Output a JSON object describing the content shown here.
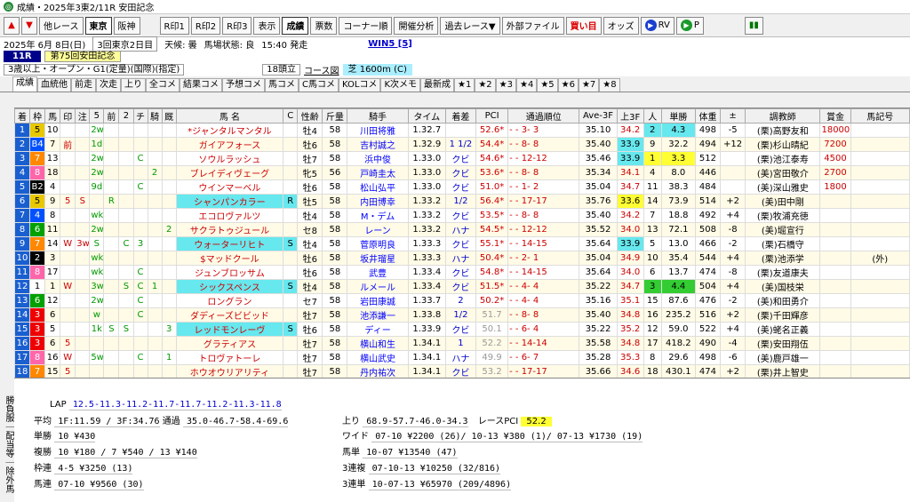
{
  "window_title": "成績・2025年3東2/11R 安田記念",
  "toolbar": {
    "up": "▲",
    "down": "▼",
    "other_race": "他レース",
    "tab_tokyo": "東京",
    "tab_hanshin": "阪神",
    "rprint1": "R印1",
    "rprint2": "R印2",
    "rprint3": "R印3",
    "display": "表示",
    "results": "成績",
    "tickets": "票数",
    "corner": "コーナー順",
    "pace": "開催分析",
    "past": "過去レース▼",
    "external": "外部ファイル",
    "buy": "買い目",
    "odds": "オッズ",
    "rv": "RV",
    "p": "P"
  },
  "info": {
    "date": "2025年 6月 8日(日)",
    "kaisai": "3回東京2日目",
    "weather": "天候: 曇",
    "track": "馬場状態: 良",
    "time": "15:40 発走",
    "win5": "WIN5 [5]"
  },
  "race": {
    "num": "11R",
    "name": "第75回安田記念",
    "cond": "3歳以上・オープン・G1(定量)(国際)(指定)",
    "runners": "18頭立",
    "course_label": "コース図",
    "course": "芝 1600m (C)"
  },
  "tabs": [
    "成績",
    "血統他",
    "前走",
    "次走",
    "上り",
    "全コメ",
    "結果コメ",
    "予想コメ",
    "馬コメ",
    "C馬コメ",
    "KOLコメ",
    "K次メモ",
    "最新成",
    "★1",
    "★2",
    "★3",
    "★4",
    "★5",
    "★6",
    "★7",
    "★8"
  ],
  "columns": [
    "着",
    "枠",
    "馬",
    "印",
    "注",
    "5",
    "前",
    "2",
    "チ",
    "騎",
    "厩",
    "馬 名",
    "C",
    "性齢",
    "斤量",
    "騎手",
    "タイム",
    "着差",
    "PCI",
    "通過順位",
    "Ave-3F",
    "上3F",
    "人",
    "単勝",
    "体重",
    "±",
    "調教師",
    "賞金",
    "馬記号"
  ],
  "rows": [
    [
      "1",
      "5",
      "10",
      "",
      "",
      "2w",
      "",
      "",
      "",
      "",
      "",
      "*ジャンタルマンタル",
      "",
      "牡4",
      "58",
      "川田将雅",
      "1.32.7",
      "",
      "52.6*",
      "- - 3- 3",
      "35.10",
      "34.2",
      "2",
      "4.3",
      "498",
      "-5",
      "(栗)高野友和",
      "18000",
      ""
    ],
    [
      "2",
      "B4",
      "7",
      "前",
      "",
      "1d",
      "",
      "",
      "",
      "",
      "",
      "ガイアフォース",
      "",
      "牡6",
      "58",
      "吉村誠之",
      "1.32.9",
      "1 1/2",
      "54.4*",
      "- - 8- 8",
      "35.40",
      "33.9",
      "9",
      "32.2",
      "494",
      "+12",
      "(栗)杉山晴紀",
      "7200",
      ""
    ],
    [
      "3",
      "7",
      "13",
      "",
      "",
      "2w",
      "",
      "",
      "C",
      "",
      "",
      "ソウルラッシュ",
      "",
      "牡7",
      "58",
      "浜中俊",
      "1.33.0",
      "クビ",
      "54.6*",
      "- - 12-12",
      "35.46",
      "33.9",
      "1",
      "3.3",
      "512",
      "",
      "(栗)池江泰寿",
      "4500",
      ""
    ],
    [
      "4",
      "8",
      "18",
      "",
      "",
      "2w",
      "",
      "",
      "",
      "2",
      "",
      "ブレイディヴェーグ",
      "",
      "牝5",
      "56",
      "戸崎圭太",
      "1.33.0",
      "クビ",
      "53.6*",
      "- - 8- 8",
      "35.34",
      "34.1",
      "4",
      "8.0",
      "446",
      "",
      "(美)宮田敬介",
      "2700",
      ""
    ],
    [
      "5",
      "B2",
      "4",
      "",
      "",
      "9d",
      "",
      "",
      "C",
      "",
      "",
      "ウインマーベル",
      "",
      "牡6",
      "58",
      "松山弘平",
      "1.33.0",
      "クビ",
      "51.0*",
      "- - 1- 2",
      "35.04",
      "34.7",
      "11",
      "38.3",
      "484",
      "",
      "(美)深山雅史",
      "1800",
      ""
    ],
    [
      "6",
      "5",
      "9",
      "5",
      "S",
      "",
      "R",
      "",
      "",
      "",
      "",
      "シャンパンカラー",
      "R",
      "牡5",
      "58",
      "内田博幸",
      "1.33.2",
      "1/2",
      "56.4*",
      "- - 17-17",
      "35.76",
      "33.6",
      "14",
      "73.9",
      "514",
      "+2",
      "(美)田中剛",
      "",
      ""
    ],
    [
      "7",
      "4",
      "8",
      "",
      "",
      "wk",
      "",
      "",
      "",
      "",
      "",
      "エコロヴァルツ",
      "",
      "牡4",
      "58",
      "M・デム",
      "1.33.2",
      "クビ",
      "53.5*",
      "- - 8- 8",
      "35.40",
      "34.2",
      "7",
      "18.8",
      "492",
      "+4",
      "(栗)牧浦充徳",
      "",
      ""
    ],
    [
      "8",
      "6",
      "11",
      "",
      "",
      "2w",
      "",
      "",
      "",
      "",
      "2",
      "サクラトゥジュール",
      "",
      "セ8",
      "58",
      "レーン",
      "1.33.2",
      "ハナ",
      "54.5*",
      "- - 12-12",
      "35.52",
      "34.0",
      "13",
      "72.1",
      "508",
      "-8",
      "(美)堀宣行",
      "",
      ""
    ],
    [
      "9",
      "7",
      "14",
      "W",
      "3w",
      "S",
      "",
      "C",
      "3",
      "",
      "",
      "ウォーターリヒト",
      "S",
      "牡4",
      "58",
      "菅原明良",
      "1.33.3",
      "クビ",
      "55.1*",
      "- - 14-15",
      "35.64",
      "33.9",
      "5",
      "13.0",
      "466",
      "-2",
      "(栗)石橋守",
      "",
      ""
    ],
    [
      "10",
      "2",
      "3",
      "",
      "",
      "wk",
      "",
      "",
      "",
      "",
      "",
      "$マッドクール",
      "",
      "牡6",
      "58",
      "坂井瑠星",
      "1.33.3",
      "ハナ",
      "50.4*",
      "- - 2- 1",
      "35.04",
      "34.9",
      "10",
      "35.4",
      "544",
      "+4",
      "(栗)池添学",
      "",
      "(外)"
    ],
    [
      "11",
      "8",
      "17",
      "",
      "",
      "wk",
      "",
      "",
      "C",
      "",
      "",
      "ジュンブロッサム",
      "",
      "牡6",
      "58",
      "武豊",
      "1.33.4",
      "クビ",
      "54.8*",
      "- - 14-15",
      "35.64",
      "34.0",
      "6",
      "13.7",
      "474",
      "-8",
      "(栗)友道康夫",
      "",
      ""
    ],
    [
      "12",
      "1",
      "1",
      "W",
      "",
      "3w",
      "",
      "S",
      "C",
      "1",
      "",
      "シックスペンス",
      "S",
      "牡4",
      "58",
      "ルメール",
      "1.33.4",
      "クビ",
      "51.5*",
      "- - 4- 4",
      "35.22",
      "34.7",
      "3",
      "4.4",
      "504",
      "+4",
      "(美)国枝栄",
      "",
      ""
    ],
    [
      "13",
      "6",
      "12",
      "",
      "",
      "2w",
      "",
      "",
      "C",
      "",
      "",
      "ロングラン",
      "",
      "セ7",
      "58",
      "岩田康誠",
      "1.33.7",
      "2",
      "50.2*",
      "- - 4- 4",
      "35.16",
      "35.1",
      "15",
      "87.6",
      "476",
      "-2",
      "(美)和田勇介",
      "",
      ""
    ],
    [
      "14",
      "3",
      "6",
      "",
      "",
      "w",
      "",
      "",
      "C",
      "",
      "",
      "ダディーズビビッド",
      "",
      "牡7",
      "58",
      "池添謙一",
      "1.33.8",
      "1/2",
      "51.7",
      "- - 8- 8",
      "35.40",
      "34.8",
      "16",
      "235.2",
      "516",
      "+2",
      "(栗)千田輝彦",
      "",
      ""
    ],
    [
      "15",
      "3",
      "5",
      "",
      "",
      "1k",
      "S",
      "S",
      "",
      "",
      "3",
      "レッドモンレーヴ",
      "S",
      "牡6",
      "58",
      "ディー",
      "1.33.9",
      "クビ",
      "50.1",
      "- - 6- 4",
      "35.22",
      "35.2",
      "12",
      "59.0",
      "522",
      "+4",
      "(美)蛯名正義",
      "",
      ""
    ],
    [
      "16",
      "3",
      "6",
      "5",
      "",
      "",
      "",
      "",
      "",
      "",
      "",
      "グラティアス",
      "",
      "牡7",
      "58",
      "横山和生",
      "1.34.1",
      "1",
      "52.2",
      "- - 14-14",
      "35.58",
      "34.8",
      "17",
      "418.2",
      "490",
      "-4",
      "(栗)安田翔伍",
      "",
      ""
    ],
    [
      "17",
      "8",
      "16",
      "W",
      "",
      "5w",
      "",
      "",
      "C",
      "",
      "1",
      "トロヴァトーレ",
      "",
      "牡7",
      "58",
      "横山武史",
      "1.34.1",
      "ハナ",
      "49.9",
      "- - 6- 7",
      "35.28",
      "35.3",
      "8",
      "29.6",
      "498",
      "-6",
      "(美)鹿戸雄一",
      "",
      ""
    ],
    [
      "18",
      "7",
      "15",
      "5",
      "",
      "",
      "",
      "",
      "",
      "",
      "",
      "ホウオウリアリティ",
      "",
      "牡7",
      "58",
      "丹内祐次",
      "1.34.1",
      "クビ",
      "53.2",
      "- - 17-17",
      "35.66",
      "34.6",
      "18",
      "430.1",
      "474",
      "+2",
      "(栗)井上智史",
      "",
      ""
    ]
  ],
  "lower": {
    "sidebar": "勝負服｜配当等｜除外馬",
    "lap_label": "LAP",
    "lap": "12.5-11.3-11.2-11.7-11.7-11.2-11.3-11.8",
    "avg_label": "平均",
    "avg": "1F:11.59 / 3F:34.76",
    "tsuka_label": "通過",
    "tsuka": "35.0-46.7-58.4-69.6",
    "agari_label": "上り",
    "agari": "68.9-57.7-46.0-34.3",
    "pci_label": "レースPCI",
    "pci": "52.2",
    "tan_label": "単勝",
    "tan": "10 ¥430",
    "fuku_label": "複勝",
    "fuku": "10 ¥180 / 7 ¥540 / 13 ¥140",
    "waku_label": "枠連",
    "waku": "4-5 ¥3250 (13)",
    "umaren_label": "馬連",
    "umaren": "07-10 ¥9560 (30)",
    "wide_label": "ワイド",
    "wide": "07-10 ¥2200 (26)/ 10-13 ¥380 (1)/ 07-13 ¥1730 (19)",
    "umatan_label": "馬単",
    "umatan": "10-07 ¥13540 (47)",
    "sanpuku_label": "3連複",
    "sanpuku": "07-10-13 ¥10250 (32/816)",
    "santan_label": "3連単",
    "santan": "10-07-13 ¥65970 (209/4896)"
  },
  "colors": {
    "waku1": "#ffffff",
    "waku2": "#000000",
    "waku3": "#e00000",
    "waku4": "#0050ff",
    "waku5": "#e8c800",
    "waku6": "#00a000",
    "waku7": "#ff8800",
    "waku8": "#ff66aa",
    "highlight_rank": "#33cc33",
    "highlight_yellow": "#ffff33",
    "highlight_cyan": "#00dddd"
  }
}
